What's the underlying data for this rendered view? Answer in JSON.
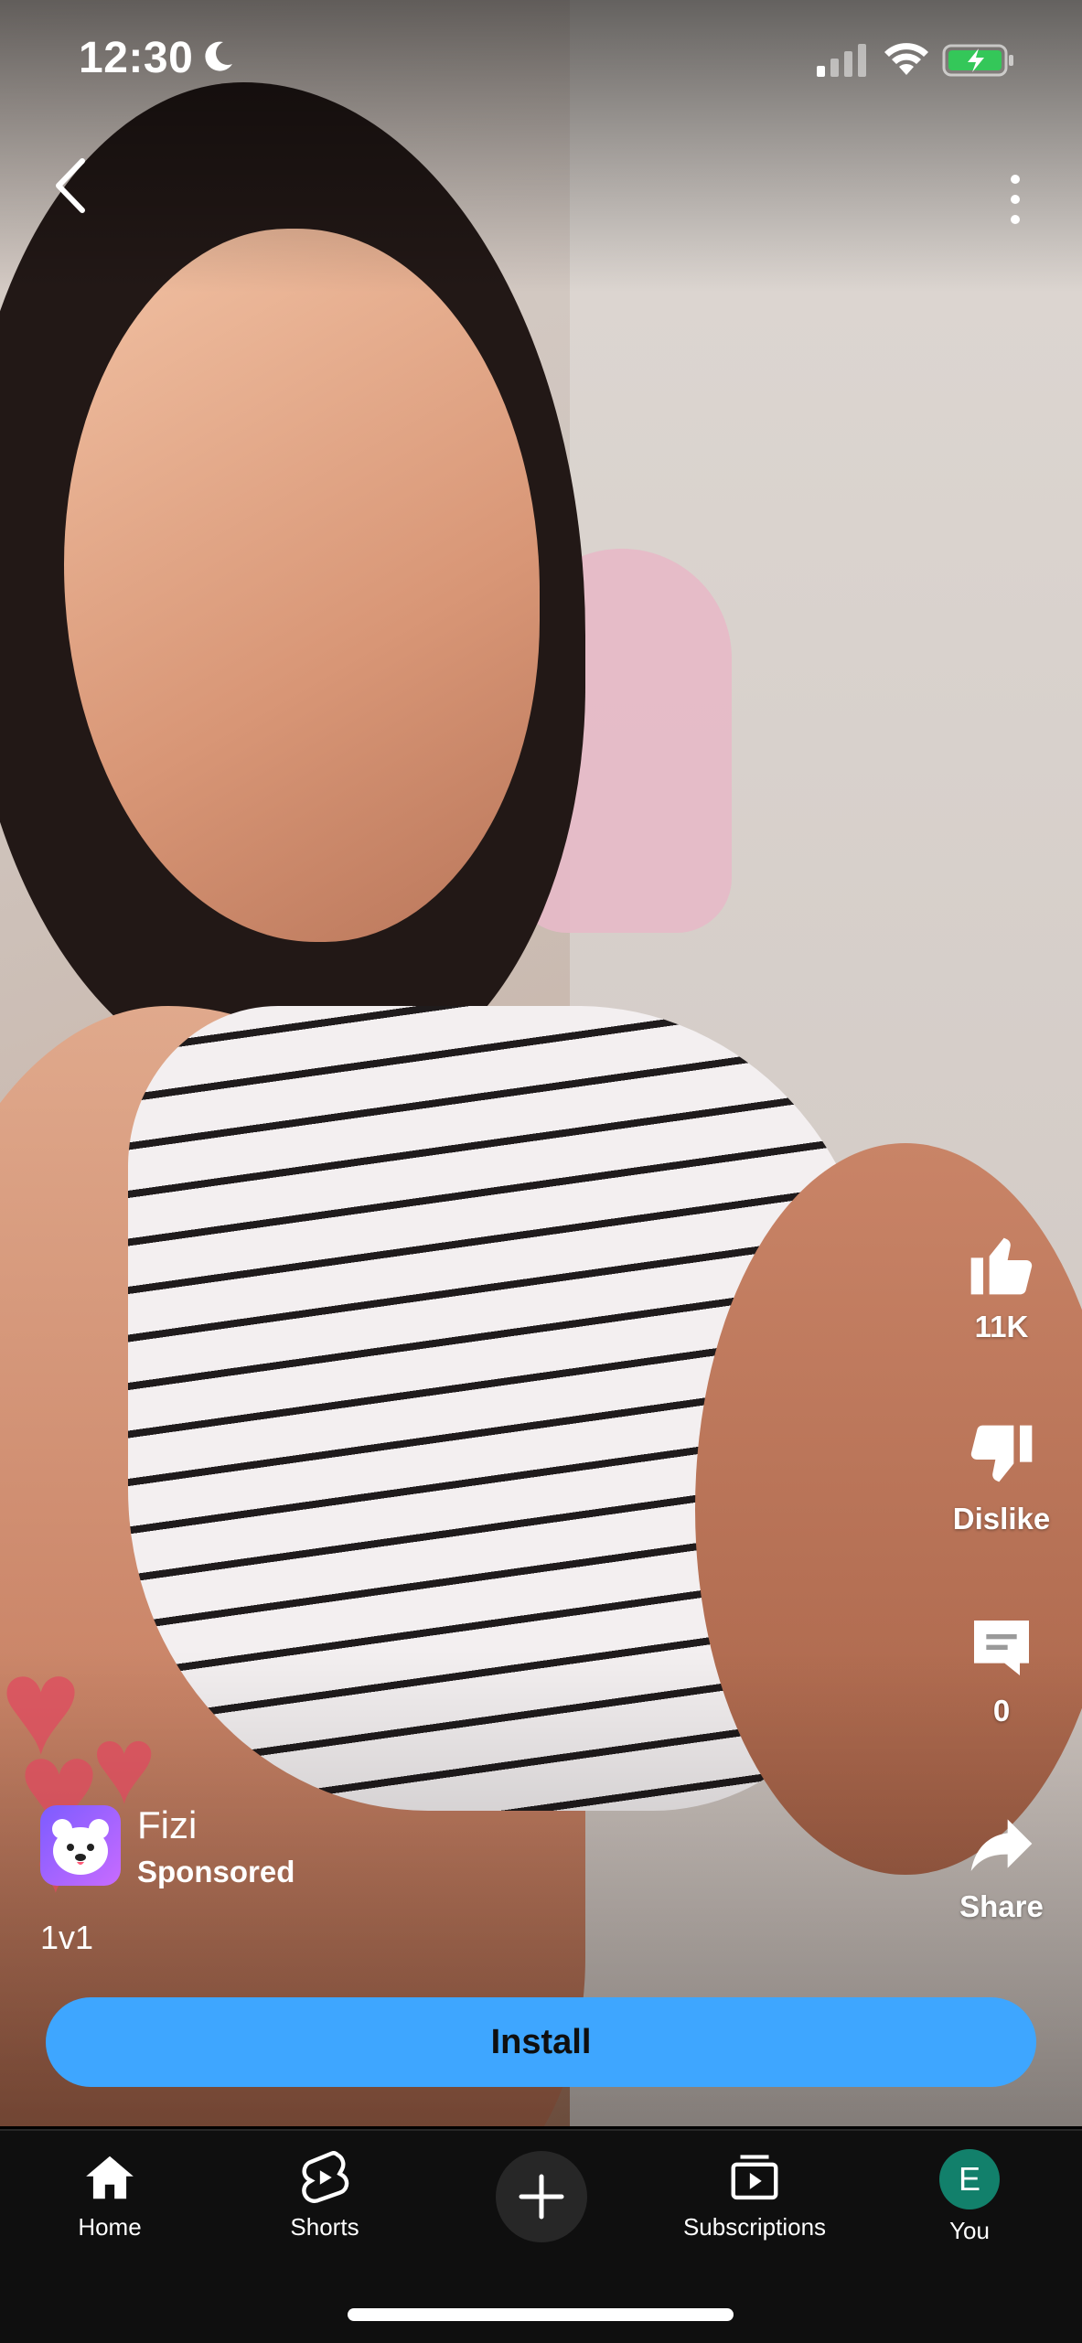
{
  "status_bar": {
    "time": "12:30"
  },
  "actions": {
    "like_count": "11K",
    "dislike_label": "Dislike",
    "comment_count": "0",
    "share_label": "Share"
  },
  "ad": {
    "app_name": "Fizi",
    "sponsored_label": "Sponsored",
    "description": "1v1",
    "install_label": "Install"
  },
  "nav": {
    "home": "Home",
    "shorts": "Shorts",
    "subscriptions": "Subscriptions",
    "you": "You",
    "avatar_letter": "E"
  },
  "colors": {
    "install_button": "#3ea6ff",
    "nav_background": "#0f0f0f",
    "avatar": "#12806b"
  },
  "icons": [
    "back-arrow-icon",
    "more-vertical-icon",
    "thumbs-up-icon",
    "thumbs-down-icon",
    "comment-icon",
    "share-icon",
    "home-icon",
    "shorts-icon",
    "plus-icon",
    "subscriptions-icon"
  ]
}
